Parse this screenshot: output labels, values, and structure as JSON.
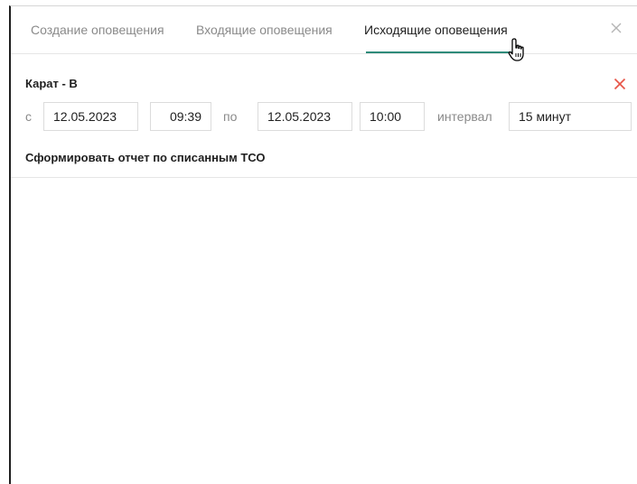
{
  "tabs": [
    {
      "label": "Создание оповещения",
      "active": false
    },
    {
      "label": "Входящие оповещения",
      "active": false
    },
    {
      "label": "Исходящие оповещения",
      "active": true
    }
  ],
  "item": {
    "title": "Карат - В",
    "from_label": "с",
    "from_date": "12.05.2023",
    "from_time": "09:39",
    "to_label": "по",
    "to_date": "12.05.2023",
    "to_time": "10:00",
    "interval_label": "интервал",
    "interval_value": "15 минут",
    "report_action": "Сформировать отчет по списанным ТСО"
  },
  "colors": {
    "accent_underline": "#2e8b7a",
    "remove_icon": "#e8574a",
    "muted_text": "#8a8a8a"
  },
  "icons": {
    "close": "close-icon",
    "remove": "remove-icon",
    "cursor": "hand-pointer-icon"
  }
}
